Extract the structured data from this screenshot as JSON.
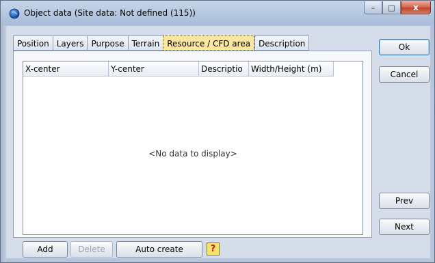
{
  "window": {
    "title": "Object data   (Site data: Not defined (115))",
    "caption": {
      "minimize": "–",
      "maximize": "□",
      "close": "x"
    },
    "icon": "globe-icon"
  },
  "tabs": [
    {
      "label": "Position",
      "active": false
    },
    {
      "label": "Layers",
      "active": false
    },
    {
      "label": "Purpose",
      "active": false
    },
    {
      "label": "Terrain",
      "active": false
    },
    {
      "label": "Resource / CFD area",
      "active": true
    },
    {
      "label": "Description",
      "active": false
    }
  ],
  "grid": {
    "columns": [
      "X-center",
      "Y-center",
      "Descriptio",
      "Width/Height (m)"
    ],
    "empty_message": "<No data to display>"
  },
  "buttons": {
    "ok": "Ok",
    "cancel": "Cancel",
    "prev": "Prev",
    "next": "Next",
    "add": "Add",
    "delete": "Delete",
    "auto_create": "Auto create",
    "help": "?"
  },
  "colors": {
    "active_tab": "#fbe7a2",
    "help_button": "#f7e36a",
    "close_button": "#c0462c"
  }
}
